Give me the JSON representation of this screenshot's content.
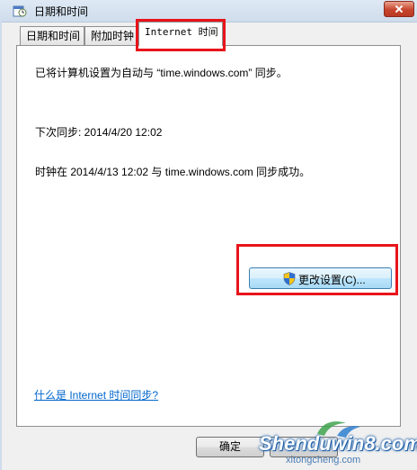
{
  "window": {
    "title": "日期和时间",
    "tabs": [
      {
        "label": "日期和时间"
      },
      {
        "label": "附加时钟"
      },
      {
        "label": "Internet 时间"
      }
    ]
  },
  "content": {
    "sync_setting": "已将计算机设置为自动与 “time.windows.com” 同步。",
    "next_sync": "下次同步: 2014/4/20 12:02",
    "last_result": "时钟在 2014/4/13 12:02 与 time.windows.com 同步成功。",
    "change_button": "更改设置(C)...",
    "help_link": "什么是 Internet 时间同步?"
  },
  "footer": {
    "ok_button": "确定"
  },
  "watermark": {
    "main": "Shenduwin8.com",
    "sub": "xitongcheng.com"
  },
  "colors": {
    "highlight": "#e8141a",
    "link": "#0066cc"
  }
}
